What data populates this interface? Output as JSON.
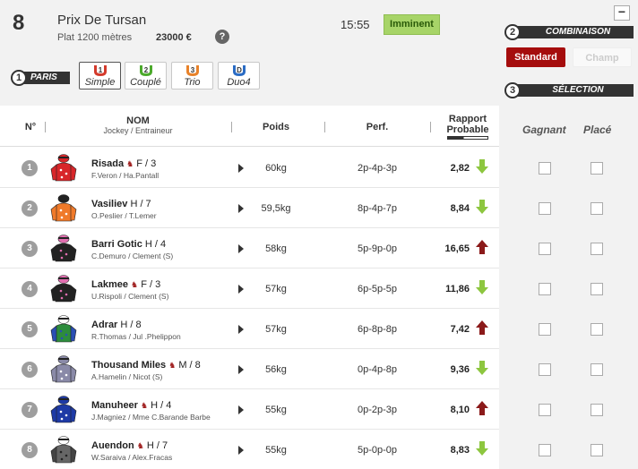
{
  "race": {
    "number": "8",
    "title": "Prix De Tursan",
    "type": "Plat 1200 mètres",
    "prize": "23000 €",
    "help": "?",
    "time": "15:55",
    "status": "Imminent"
  },
  "steps": {
    "paris": {
      "num": "1",
      "label": "PARIS"
    },
    "combinaison": {
      "num": "2",
      "label": "COMBINAISON"
    },
    "selection": {
      "num": "3",
      "label": "SÉLECTION"
    }
  },
  "bet_types": [
    {
      "label": "Simple",
      "badge": "1",
      "color": "#d33a2c",
      "active": true
    },
    {
      "label": "Couplé",
      "badge": "2",
      "color": "#4caa2c",
      "active": false
    },
    {
      "label": "Trio",
      "badge": "3",
      "color": "#e8822a",
      "active": false
    },
    {
      "label": "Duo4",
      "badge": "D",
      "color": "#2b6cc4",
      "active": false
    }
  ],
  "combinaison": {
    "standard": "Standard",
    "champ": "Champ"
  },
  "collapse": "−",
  "table": {
    "col_num": "N°",
    "col_name": "NOM",
    "col_name_sub": "Jockey / Entraineur",
    "col_weight": "Poids",
    "col_perf": "Perf.",
    "col_odds": "Rapport",
    "col_odds_sub": "Probable",
    "col_gagnant": "Gagnant",
    "col_place": "Placé"
  },
  "runners": [
    {
      "num": "1",
      "name": "Risada",
      "mare": true,
      "info": "F / 3",
      "jockey": "F.Veron / Ha.Pantall",
      "weight": "60kg",
      "perf": "2p-4p-3p",
      "odds": "2,82",
      "trend": "down",
      "silk": {
        "body": "#d8262a",
        "sleeve": "#d8262a",
        "cap": "#d8262a",
        "pattern": "#ffffff"
      }
    },
    {
      "num": "2",
      "name": "Vasiliev",
      "mare": false,
      "info": "H / 7",
      "jockey": "O.Peslier / T.Lemer",
      "weight": "59,5kg",
      "perf": "8p-4p-7p",
      "odds": "8,84",
      "trend": "down",
      "silk": {
        "body": "#f07a2a",
        "sleeve": "#f07a2a",
        "cap": "#222222",
        "pattern": "#ffffff"
      }
    },
    {
      "num": "3",
      "name": "Barri Gotic",
      "mare": false,
      "info": "H / 4",
      "jockey": "C.Demuro / Clement (S)",
      "weight": "58kg",
      "perf": "5p-9p-0p",
      "odds": "16,65",
      "trend": "up",
      "silk": {
        "body": "#222222",
        "sleeve": "#222222",
        "cap": "#e26fb0",
        "pattern": "#e26fb0"
      }
    },
    {
      "num": "4",
      "name": "Lakmee",
      "mare": true,
      "info": "F / 3",
      "jockey": "U.Rispoli / Clement (S)",
      "weight": "57kg",
      "perf": "6p-5p-5p",
      "odds": "11,86",
      "trend": "down",
      "silk": {
        "body": "#222222",
        "sleeve": "#222222",
        "cap": "#e26fb0",
        "pattern": "#e26fb0"
      }
    },
    {
      "num": "5",
      "name": "Adrar",
      "mare": false,
      "info": "H / 8",
      "jockey": "R.Thomas / Jul .Phelippon",
      "weight": "57kg",
      "perf": "6p-8p-8p",
      "odds": "7,42",
      "trend": "up",
      "silk": {
        "body": "#2d8c3c",
        "sleeve": "#2a4fb4",
        "cap": "#ffffff",
        "pattern": "#2a4fb4"
      }
    },
    {
      "num": "6",
      "name": "Thousand Miles",
      "mare": true,
      "info": "M / 8",
      "jockey": "A.Hamelin / Nicot (S)",
      "weight": "56kg",
      "perf": "0p-4p-8p",
      "odds": "9,36",
      "trend": "down",
      "silk": {
        "body": "#8a8aa8",
        "sleeve": "#8a8aa8",
        "cap": "#8a8aa8",
        "pattern": "#ffffff"
      }
    },
    {
      "num": "7",
      "name": "Manuheer",
      "mare": true,
      "info": "H / 4",
      "jockey": "J.Magniez / Mme C.Barande Barbe",
      "weight": "55kg",
      "perf": "0p-2p-3p",
      "odds": "8,10",
      "trend": "up",
      "silk": {
        "body": "#1e3aa6",
        "sleeve": "#1e3aa6",
        "cap": "#1e3aa6",
        "pattern": "#ffffff"
      }
    },
    {
      "num": "8",
      "name": "Auendon",
      "mare": true,
      "info": "H / 7",
      "jockey": "W.Saraiva / Alex.Fracas",
      "weight": "55kg",
      "perf": "5p-0p-0p",
      "odds": "8,83",
      "trend": "down",
      "silk": {
        "body": "#666666",
        "sleeve": "#444444",
        "cap": "#ffffff",
        "pattern": "#222222"
      }
    }
  ],
  "colors": {
    "accent": "#a50d0d",
    "down": "#8dc63f",
    "up": "#8b1a1a",
    "imminent": "#a7d468"
  }
}
